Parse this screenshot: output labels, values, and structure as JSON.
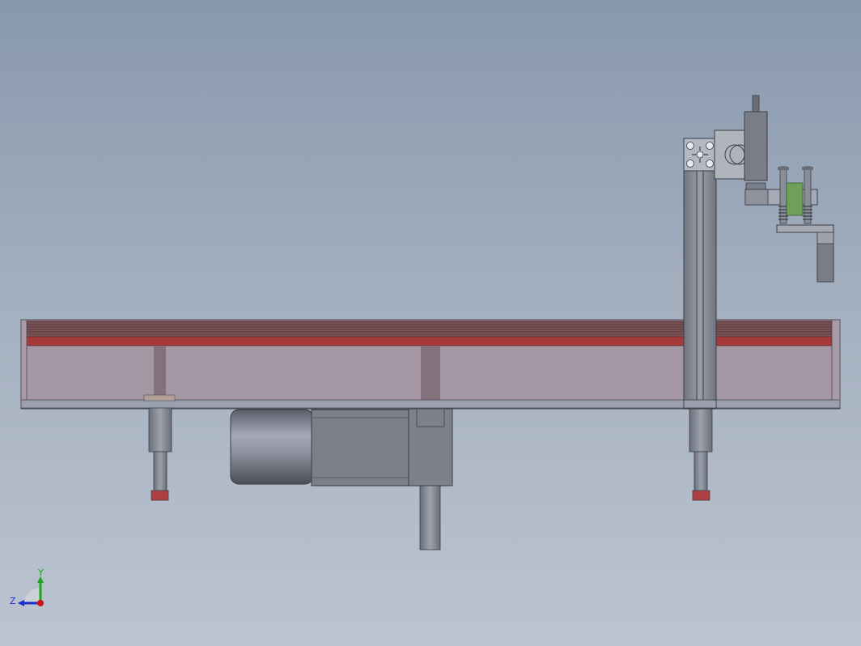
{
  "view": {
    "background_top": "#8898ac",
    "background_bottom": "#bcc4d0"
  },
  "triad": {
    "x_axis_label": "Z",
    "y_axis_label": "Y",
    "colors": {
      "y": "#1aa81a",
      "z": "#1a2ed0",
      "x": "#d01010"
    }
  },
  "model": {
    "frame_color": "#9aa0ac",
    "belt_color": "#a63a3a",
    "panel_color": "#a598a4",
    "motor_color": "#7a7f8a",
    "foot_pad_color": "#b04040",
    "gripper_pad_color": "#6ea05a"
  }
}
